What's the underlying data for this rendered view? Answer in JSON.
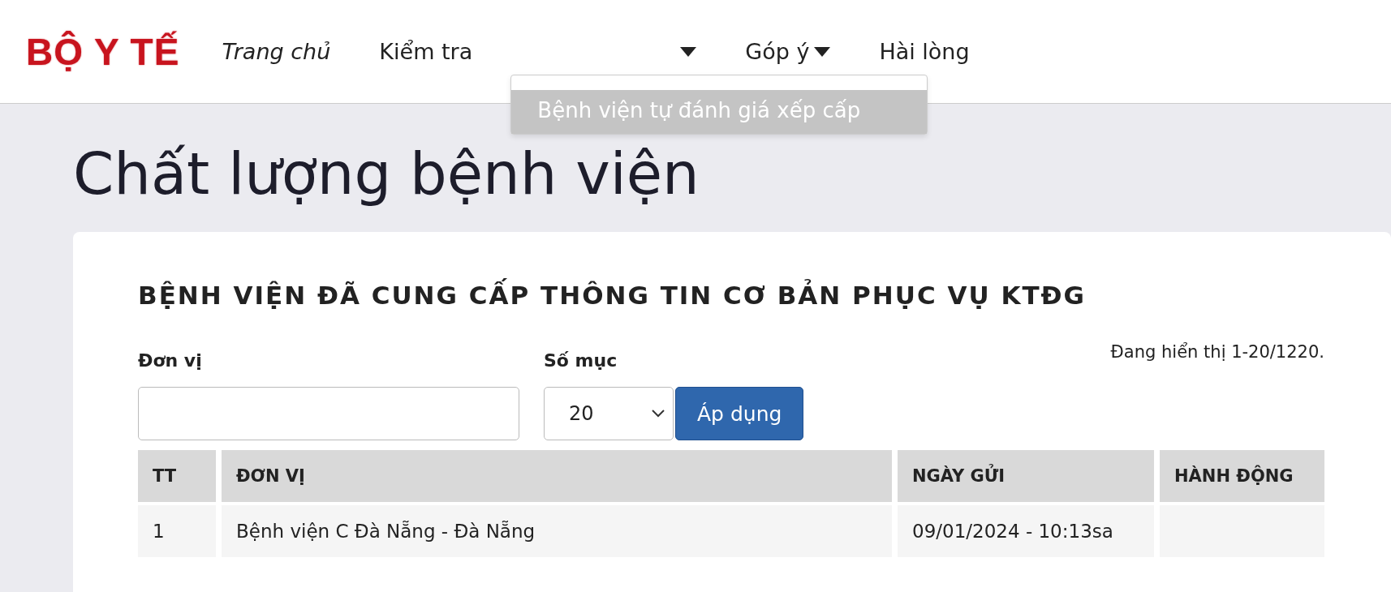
{
  "logo": {
    "text": "BỘ Y TẾ"
  },
  "nav": [
    {
      "label": "Trang chủ",
      "kind": "link",
      "selected": true
    },
    {
      "label": "Kiểm tra",
      "kind": "dropdown",
      "selected": false,
      "expanded": true,
      "menu": [
        {
          "label": "Bệnh viện tự đánh giá xếp cấp",
          "selected": true
        }
      ]
    },
    {
      "label": "Góp ý",
      "kind": "dropdown",
      "selected": false,
      "expanded": false
    },
    {
      "label": "Hài lòng",
      "kind": "link",
      "selected": false
    }
  ],
  "page_title": "Chất lượng bệnh viện",
  "card": {
    "title": "BỆNH VIỆN ĐÃ CUNG CẤP THÔNG TIN CƠ BẢN PHỤC VỤ KTĐG",
    "filter": {
      "unit_label": "Đơn vị",
      "count_label": "Số mục",
      "count_value": "20",
      "apply_button": "Áp dụng"
    },
    "showing": "Đang hiển thị 1-20/1220.",
    "table": {
      "columns": [
        "TT",
        "ĐƠN VỊ",
        "NGÀY GỬI",
        "HÀNH ĐỘNG"
      ],
      "rows": [
        [
          "1",
          "Bệnh viện C Đà Nẵng - Đà Nẵng",
          "09/01/2024 - 10:13sa",
          ""
        ]
      ]
    }
  }
}
